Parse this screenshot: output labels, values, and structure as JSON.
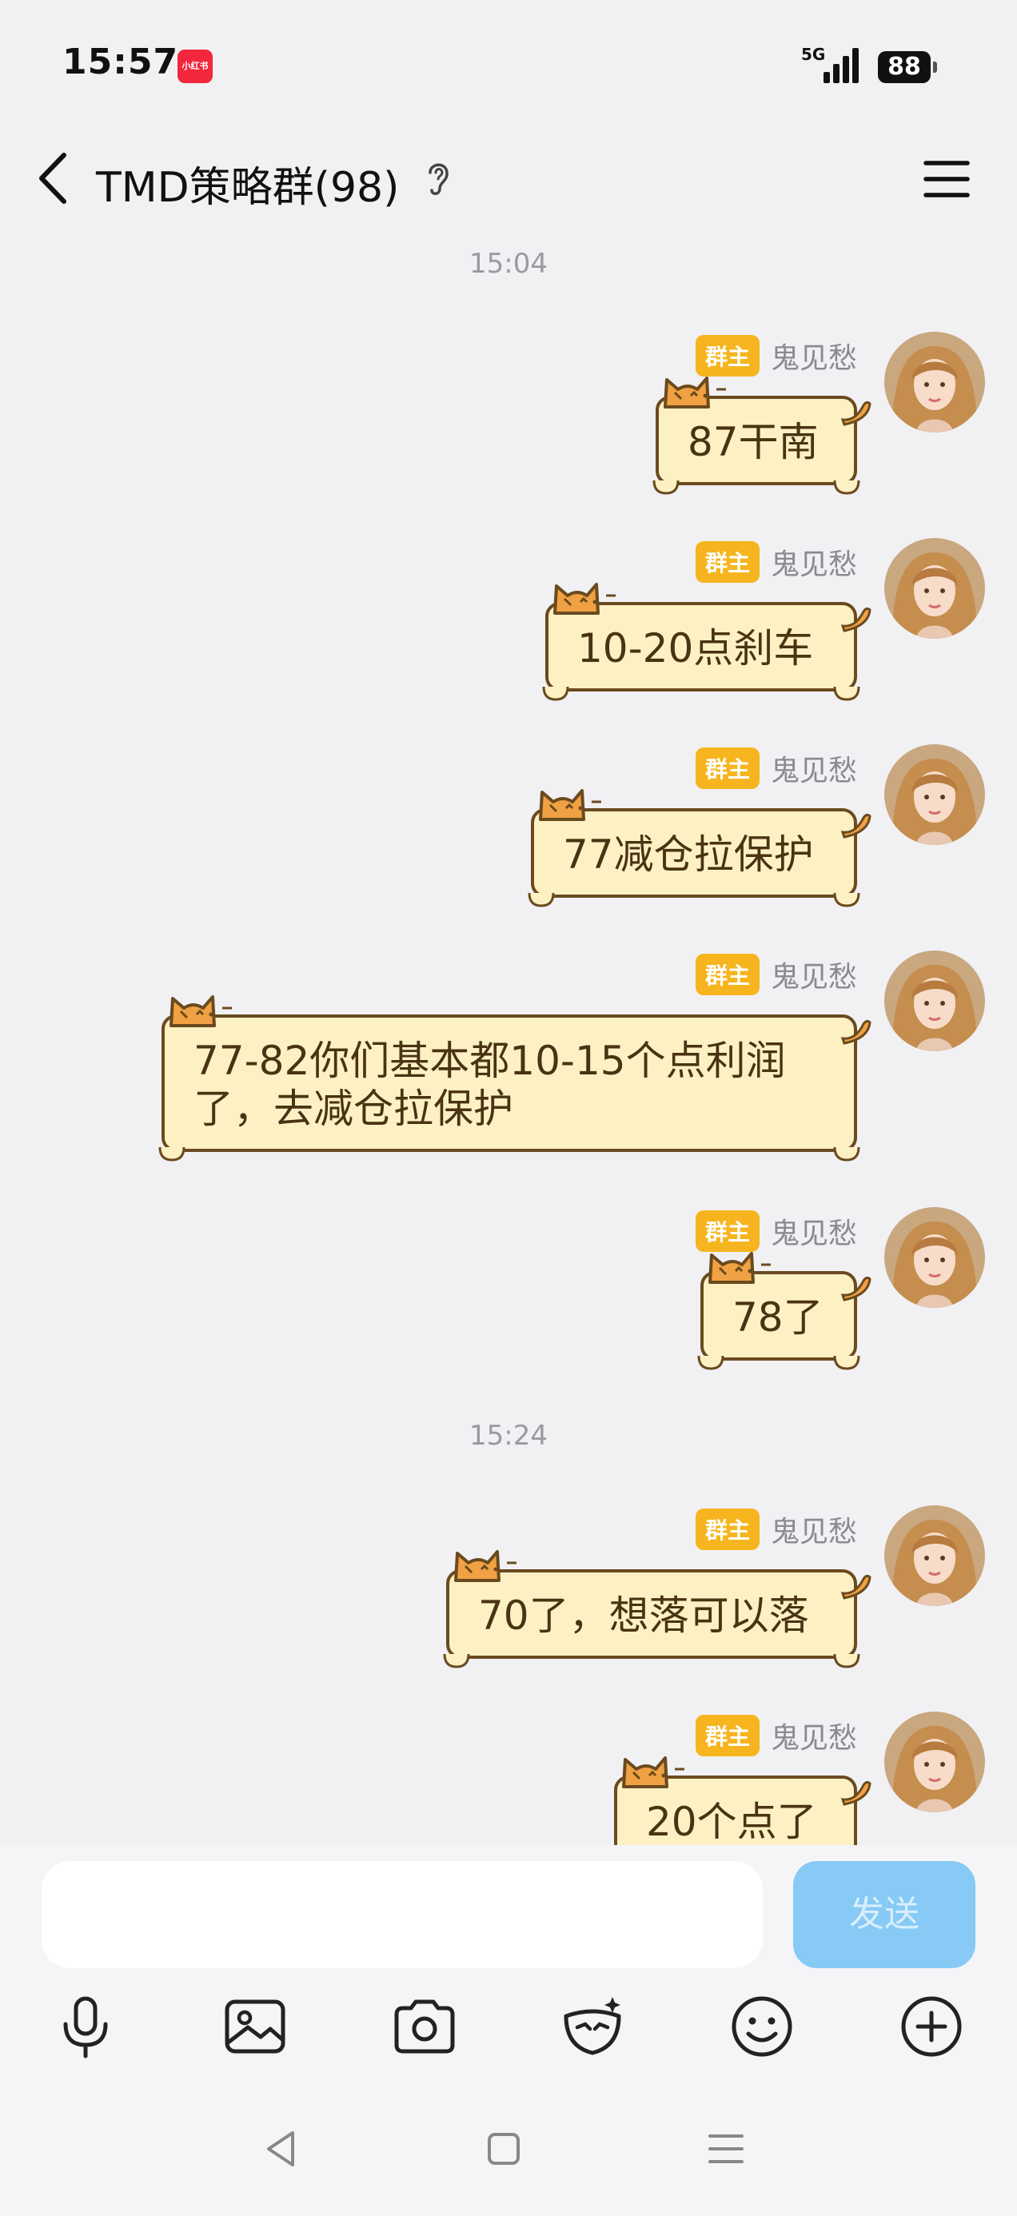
{
  "status_bar": {
    "time": "15:57",
    "app_icon_text": "小红书",
    "network": "5G",
    "battery": "88"
  },
  "header": {
    "title": "TMD策略群(98)"
  },
  "messages": {
    "timestamp_1": "15:04",
    "timestamp_2": "15:24",
    "badge": "群主",
    "sender": "鬼见愁",
    "m1": "87干南",
    "m2": "10-20点刹车",
    "m3": "77减仓拉保护",
    "m4_line1": "77-82你们基本都10-15个点利润",
    "m4_line2": "了，去减仓拉保护",
    "m5": "78了",
    "m6": "70了，想落可以落",
    "m7": "20个点了"
  },
  "input": {
    "placeholder": "",
    "send_label": "发送"
  },
  "colors": {
    "badge": "#f6b51f",
    "bubble": "#fdf1c4",
    "send": "#86caf5"
  }
}
